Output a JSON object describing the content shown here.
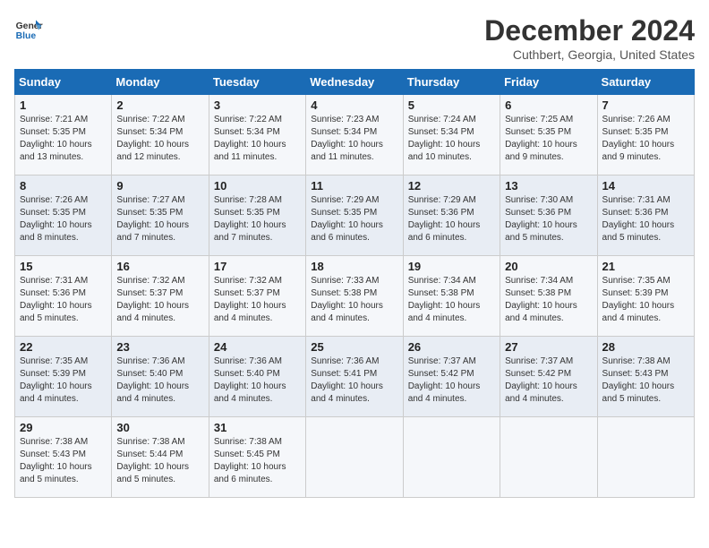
{
  "logo": {
    "line1": "General",
    "line2": "Blue"
  },
  "title": "December 2024",
  "subtitle": "Cuthbert, Georgia, United States",
  "days_of_week": [
    "Sunday",
    "Monday",
    "Tuesday",
    "Wednesday",
    "Thursday",
    "Friday",
    "Saturday"
  ],
  "weeks": [
    [
      {
        "day": 1,
        "lines": [
          "Sunrise: 7:21 AM",
          "Sunset: 5:35 PM",
          "Daylight: 10 hours",
          "and 13 minutes."
        ]
      },
      {
        "day": 2,
        "lines": [
          "Sunrise: 7:22 AM",
          "Sunset: 5:34 PM",
          "Daylight: 10 hours",
          "and 12 minutes."
        ]
      },
      {
        "day": 3,
        "lines": [
          "Sunrise: 7:22 AM",
          "Sunset: 5:34 PM",
          "Daylight: 10 hours",
          "and 11 minutes."
        ]
      },
      {
        "day": 4,
        "lines": [
          "Sunrise: 7:23 AM",
          "Sunset: 5:34 PM",
          "Daylight: 10 hours",
          "and 11 minutes."
        ]
      },
      {
        "day": 5,
        "lines": [
          "Sunrise: 7:24 AM",
          "Sunset: 5:34 PM",
          "Daylight: 10 hours",
          "and 10 minutes."
        ]
      },
      {
        "day": 6,
        "lines": [
          "Sunrise: 7:25 AM",
          "Sunset: 5:35 PM",
          "Daylight: 10 hours",
          "and 9 minutes."
        ]
      },
      {
        "day": 7,
        "lines": [
          "Sunrise: 7:26 AM",
          "Sunset: 5:35 PM",
          "Daylight: 10 hours",
          "and 9 minutes."
        ]
      }
    ],
    [
      {
        "day": 8,
        "lines": [
          "Sunrise: 7:26 AM",
          "Sunset: 5:35 PM",
          "Daylight: 10 hours",
          "and 8 minutes."
        ]
      },
      {
        "day": 9,
        "lines": [
          "Sunrise: 7:27 AM",
          "Sunset: 5:35 PM",
          "Daylight: 10 hours",
          "and 7 minutes."
        ]
      },
      {
        "day": 10,
        "lines": [
          "Sunrise: 7:28 AM",
          "Sunset: 5:35 PM",
          "Daylight: 10 hours",
          "and 7 minutes."
        ]
      },
      {
        "day": 11,
        "lines": [
          "Sunrise: 7:29 AM",
          "Sunset: 5:35 PM",
          "Daylight: 10 hours",
          "and 6 minutes."
        ]
      },
      {
        "day": 12,
        "lines": [
          "Sunrise: 7:29 AM",
          "Sunset: 5:36 PM",
          "Daylight: 10 hours",
          "and 6 minutes."
        ]
      },
      {
        "day": 13,
        "lines": [
          "Sunrise: 7:30 AM",
          "Sunset: 5:36 PM",
          "Daylight: 10 hours",
          "and 5 minutes."
        ]
      },
      {
        "day": 14,
        "lines": [
          "Sunrise: 7:31 AM",
          "Sunset: 5:36 PM",
          "Daylight: 10 hours",
          "and 5 minutes."
        ]
      }
    ],
    [
      {
        "day": 15,
        "lines": [
          "Sunrise: 7:31 AM",
          "Sunset: 5:36 PM",
          "Daylight: 10 hours",
          "and 5 minutes."
        ]
      },
      {
        "day": 16,
        "lines": [
          "Sunrise: 7:32 AM",
          "Sunset: 5:37 PM",
          "Daylight: 10 hours",
          "and 4 minutes."
        ]
      },
      {
        "day": 17,
        "lines": [
          "Sunrise: 7:32 AM",
          "Sunset: 5:37 PM",
          "Daylight: 10 hours",
          "and 4 minutes."
        ]
      },
      {
        "day": 18,
        "lines": [
          "Sunrise: 7:33 AM",
          "Sunset: 5:38 PM",
          "Daylight: 10 hours",
          "and 4 minutes."
        ]
      },
      {
        "day": 19,
        "lines": [
          "Sunrise: 7:34 AM",
          "Sunset: 5:38 PM",
          "Daylight: 10 hours",
          "and 4 minutes."
        ]
      },
      {
        "day": 20,
        "lines": [
          "Sunrise: 7:34 AM",
          "Sunset: 5:38 PM",
          "Daylight: 10 hours",
          "and 4 minutes."
        ]
      },
      {
        "day": 21,
        "lines": [
          "Sunrise: 7:35 AM",
          "Sunset: 5:39 PM",
          "Daylight: 10 hours",
          "and 4 minutes."
        ]
      }
    ],
    [
      {
        "day": 22,
        "lines": [
          "Sunrise: 7:35 AM",
          "Sunset: 5:39 PM",
          "Daylight: 10 hours",
          "and 4 minutes."
        ]
      },
      {
        "day": 23,
        "lines": [
          "Sunrise: 7:36 AM",
          "Sunset: 5:40 PM",
          "Daylight: 10 hours",
          "and 4 minutes."
        ]
      },
      {
        "day": 24,
        "lines": [
          "Sunrise: 7:36 AM",
          "Sunset: 5:40 PM",
          "Daylight: 10 hours",
          "and 4 minutes."
        ]
      },
      {
        "day": 25,
        "lines": [
          "Sunrise: 7:36 AM",
          "Sunset: 5:41 PM",
          "Daylight: 10 hours",
          "and 4 minutes."
        ]
      },
      {
        "day": 26,
        "lines": [
          "Sunrise: 7:37 AM",
          "Sunset: 5:42 PM",
          "Daylight: 10 hours",
          "and 4 minutes."
        ]
      },
      {
        "day": 27,
        "lines": [
          "Sunrise: 7:37 AM",
          "Sunset: 5:42 PM",
          "Daylight: 10 hours",
          "and 4 minutes."
        ]
      },
      {
        "day": 28,
        "lines": [
          "Sunrise: 7:38 AM",
          "Sunset: 5:43 PM",
          "Daylight: 10 hours",
          "and 5 minutes."
        ]
      }
    ],
    [
      {
        "day": 29,
        "lines": [
          "Sunrise: 7:38 AM",
          "Sunset: 5:43 PM",
          "Daylight: 10 hours",
          "and 5 minutes."
        ]
      },
      {
        "day": 30,
        "lines": [
          "Sunrise: 7:38 AM",
          "Sunset: 5:44 PM",
          "Daylight: 10 hours",
          "and 5 minutes."
        ]
      },
      {
        "day": 31,
        "lines": [
          "Sunrise: 7:38 AM",
          "Sunset: 5:45 PM",
          "Daylight: 10 hours",
          "and 6 minutes."
        ]
      },
      null,
      null,
      null,
      null
    ]
  ]
}
